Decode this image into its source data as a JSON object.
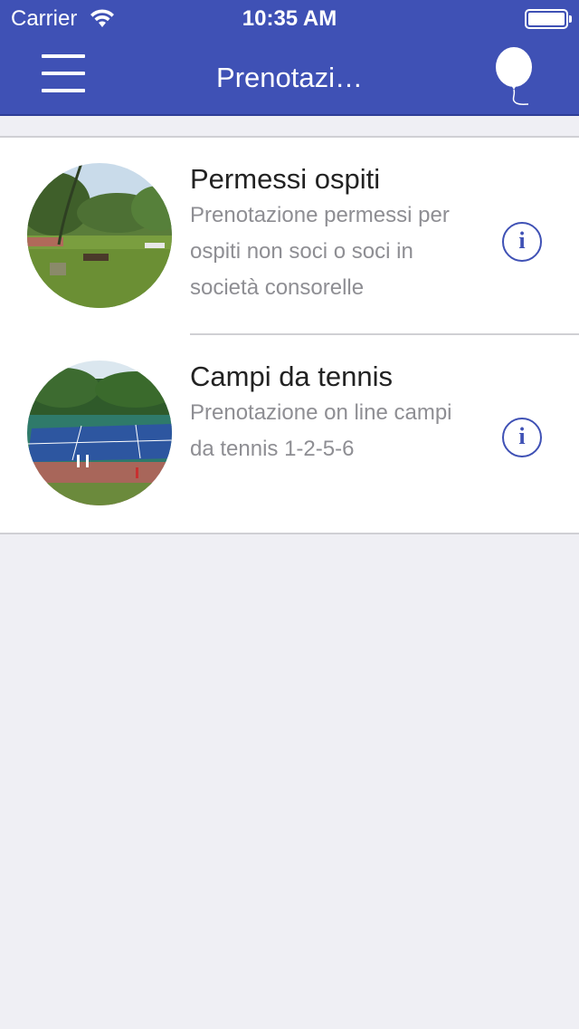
{
  "status_bar": {
    "carrier": "Carrier",
    "time": "10:35 AM",
    "wifi_icon": "wifi-icon",
    "battery_icon": "battery-icon"
  },
  "nav": {
    "title": "Prenotazi…",
    "menu_icon": "hamburger-menu-icon",
    "balloon_icon": "balloon-icon",
    "background_color": "#3f51b5"
  },
  "list": {
    "items": [
      {
        "title": "Permessi ospiti",
        "description": "Prenotazione permessi per ospiti non soci o soci in società consorelle",
        "image": "park-lawn-photo",
        "info_icon": "info-icon"
      },
      {
        "title": "Campi da tennis",
        "description": "Prenotazione on line campi da tennis 1-2-5-6",
        "image": "tennis-courts-photo",
        "info_icon": "info-icon"
      }
    ]
  },
  "info_glyph": "i",
  "accent_color": "#3f51b5"
}
